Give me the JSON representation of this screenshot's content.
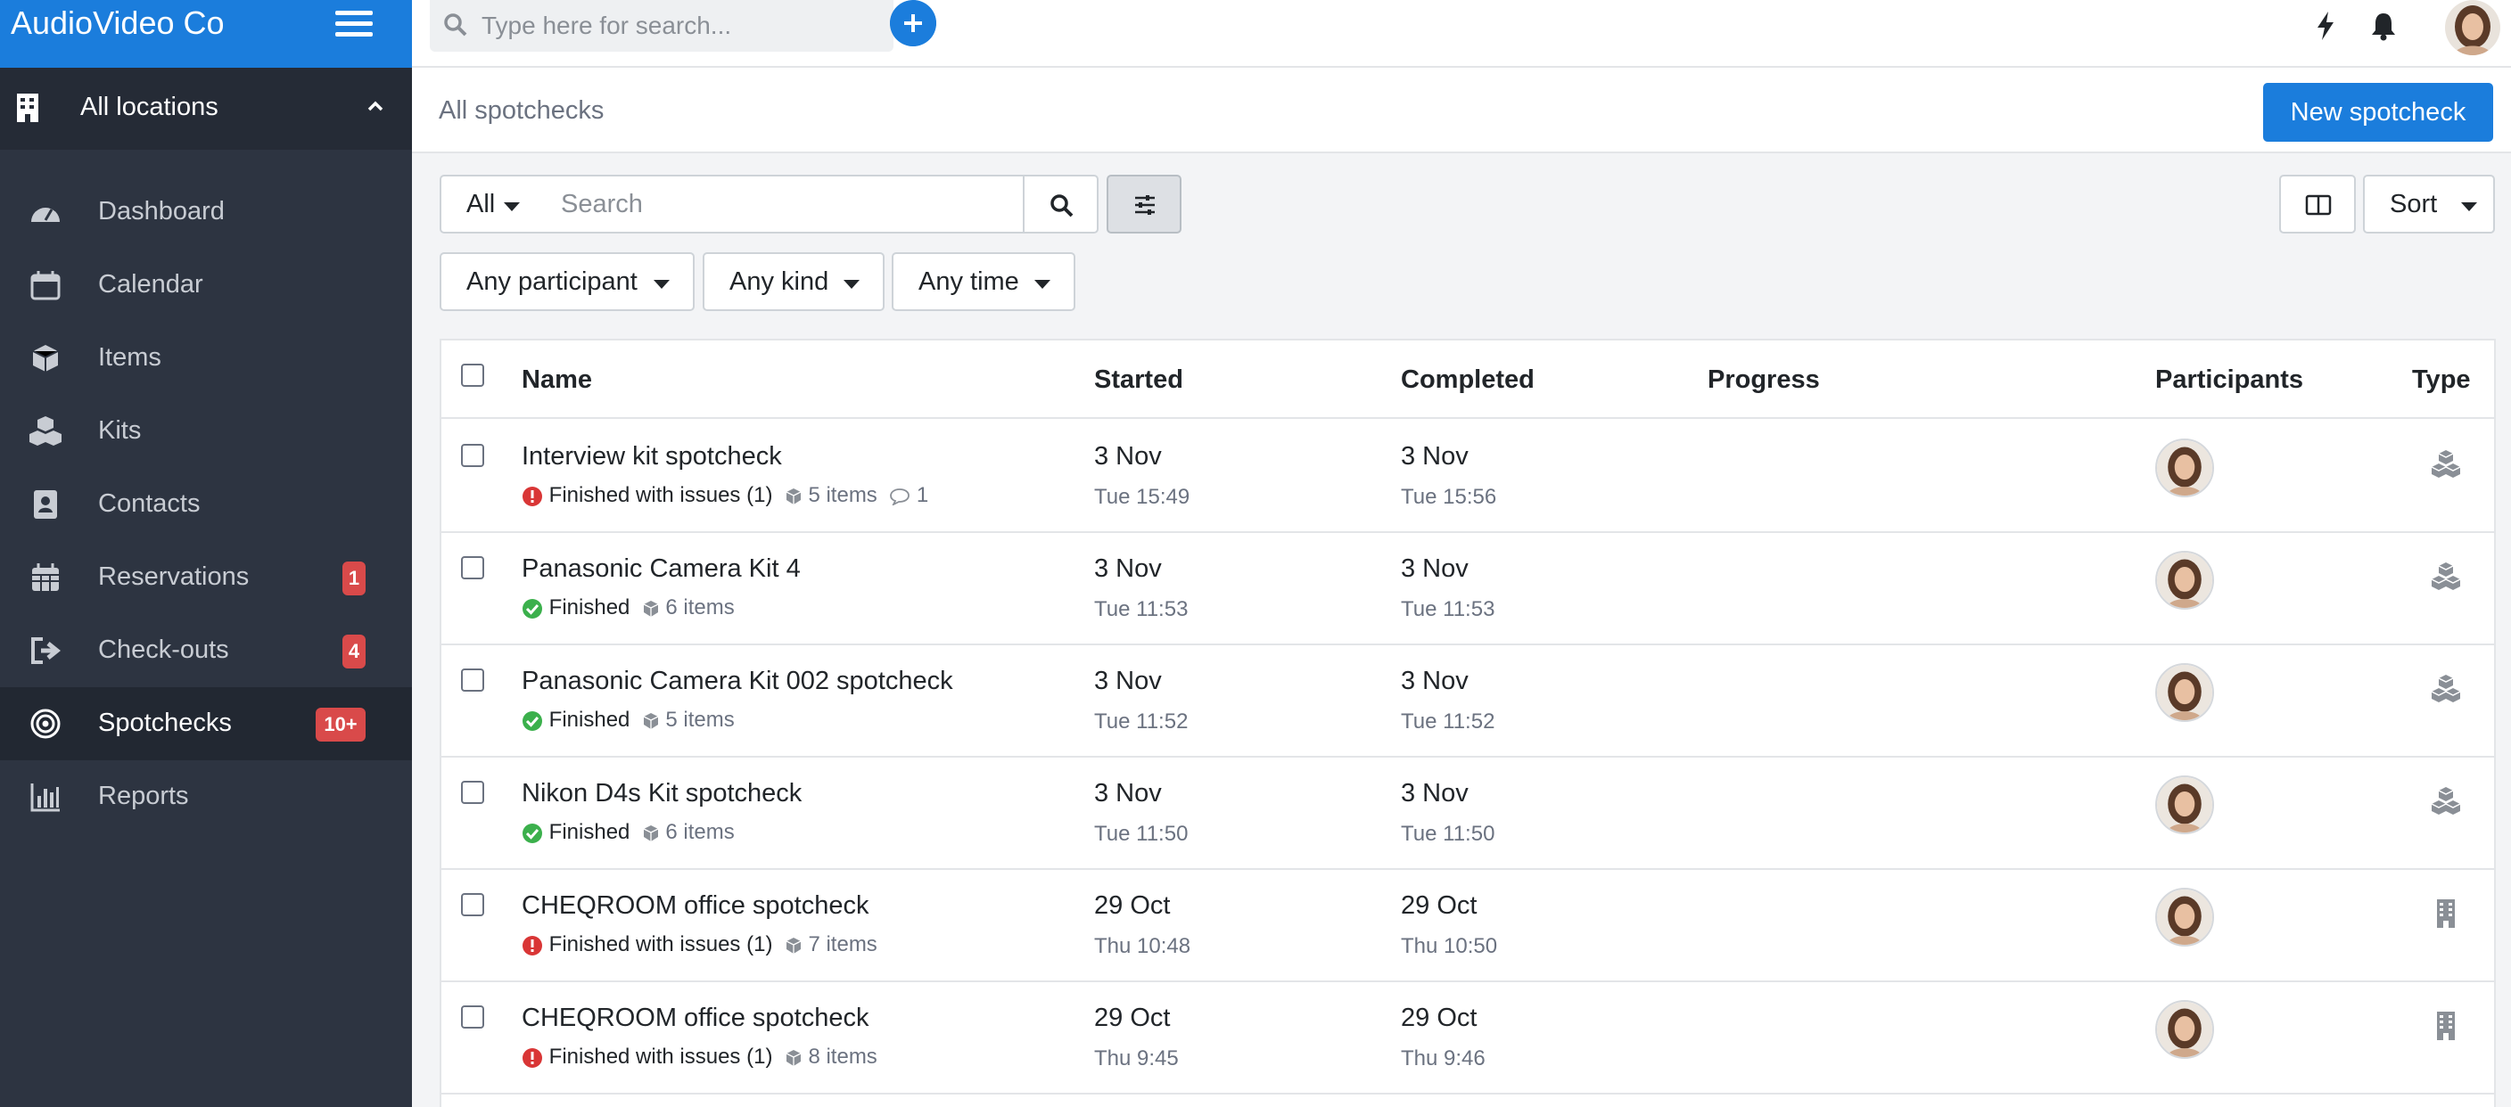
{
  "sidebar": {
    "brand": "AudioVideo Co",
    "location": "All locations",
    "items": [
      {
        "label": "Dashboard",
        "icon": "dashboard-icon"
      },
      {
        "label": "Calendar",
        "icon": "calendar-icon"
      },
      {
        "label": "Items",
        "icon": "cube-icon"
      },
      {
        "label": "Kits",
        "icon": "cubes-icon"
      },
      {
        "label": "Contacts",
        "icon": "contact-book-icon"
      },
      {
        "label": "Reservations",
        "icon": "calendar-grid-icon",
        "badge": "1"
      },
      {
        "label": "Check-outs",
        "icon": "sign-out-icon",
        "badge": "4"
      },
      {
        "label": "Spotchecks",
        "icon": "target-icon",
        "badge": "10+",
        "active": true
      },
      {
        "label": "Reports",
        "icon": "bar-chart-icon"
      }
    ]
  },
  "topbar": {
    "search_placeholder": "Type here for search..."
  },
  "header": {
    "breadcrumb": "All spotchecks",
    "new_button": "New spotcheck"
  },
  "filters": {
    "scope": "All",
    "search_placeholder": "Search",
    "participant": "Any participant",
    "kind": "Any kind",
    "time": "Any time",
    "sort": "Sort"
  },
  "table": {
    "columns": {
      "name": "Name",
      "started": "Started",
      "completed": "Completed",
      "progress": "Progress",
      "participants": "Participants",
      "type": "Type"
    },
    "rows": [
      {
        "name": "Interview kit spotcheck",
        "status": "Finished with issues (1)",
        "status_kind": "issues",
        "items": "5 items",
        "comments": "1",
        "started_date": "3 Nov",
        "started_time": "Tue 15:49",
        "completed_date": "3 Nov",
        "completed_time": "Tue 15:56",
        "type_icon": "kit-icon"
      },
      {
        "name": "Panasonic Camera Kit 4",
        "status": "Finished",
        "status_kind": "ok",
        "items": "6 items",
        "comments": "",
        "started_date": "3 Nov",
        "started_time": "Tue 11:53",
        "completed_date": "3 Nov",
        "completed_time": "Tue 11:53",
        "type_icon": "kit-icon"
      },
      {
        "name": "Panasonic Camera Kit 002 spotcheck",
        "status": "Finished",
        "status_kind": "ok",
        "items": "5 items",
        "comments": "",
        "started_date": "3 Nov",
        "started_time": "Tue 11:52",
        "completed_date": "3 Nov",
        "completed_time": "Tue 11:52",
        "type_icon": "kit-icon"
      },
      {
        "name": "Nikon D4s Kit spotcheck",
        "status": "Finished",
        "status_kind": "ok",
        "items": "6 items",
        "comments": "",
        "started_date": "3 Nov",
        "started_time": "Tue 11:50",
        "completed_date": "3 Nov",
        "completed_time": "Tue 11:50",
        "type_icon": "kit-icon"
      },
      {
        "name": "CHEQROOM office spotcheck",
        "status": "Finished with issues (1)",
        "status_kind": "issues",
        "items": "7 items",
        "comments": "",
        "started_date": "29 Oct",
        "started_time": "Thu 10:48",
        "completed_date": "29 Oct",
        "completed_time": "Thu 10:50",
        "type_icon": "building-icon"
      },
      {
        "name": "CHEQROOM office spotcheck",
        "status": "Finished with issues (1)",
        "status_kind": "issues",
        "items": "8 items",
        "comments": "",
        "started_date": "29 Oct",
        "started_time": "Thu 9:45",
        "completed_date": "29 Oct",
        "completed_time": "Thu 9:46",
        "type_icon": "building-icon"
      }
    ]
  },
  "colors": {
    "accent": "#1b7ddc",
    "sidebar_bg": "#2d3441",
    "badge": "#d94a4a",
    "ok": "#3bb04c",
    "issue": "#d93636"
  }
}
